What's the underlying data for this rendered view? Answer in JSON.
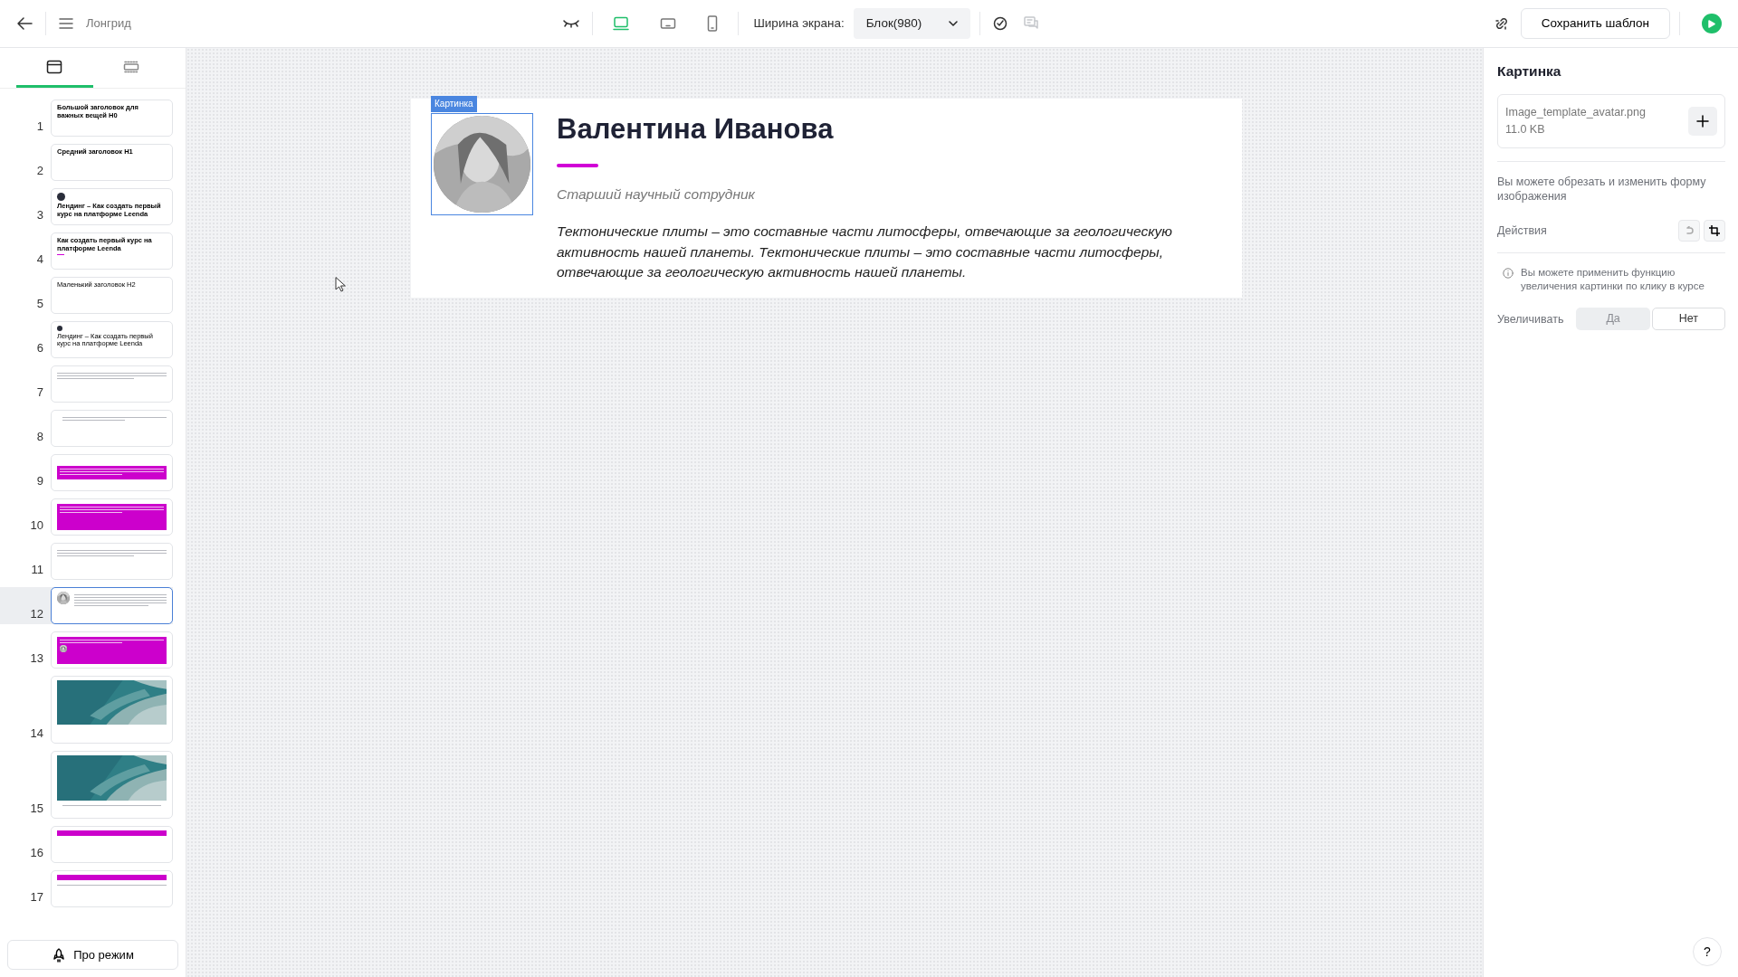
{
  "topbar": {
    "title": "Лонгрид",
    "width_label": "Ширина экрана:",
    "width_select": "Блок(980)",
    "save_button": "Сохранить шаблон",
    "devices": [
      {
        "kind": "desktop",
        "selected": true
      },
      {
        "kind": "tablet",
        "selected": false
      },
      {
        "kind": "mobile",
        "selected": false
      }
    ]
  },
  "sidebar": {
    "tabs": [
      {
        "kind": "blocks",
        "selected": true
      },
      {
        "kind": "layout",
        "selected": false
      }
    ],
    "slides": [
      {
        "number": "1",
        "kind": "heading",
        "title": "Большой заголовок для важных вещей H0",
        "selected": false
      },
      {
        "number": "2",
        "kind": "heading-medium",
        "title": "Средний заголовок H1",
        "selected": false
      },
      {
        "number": "3",
        "kind": "avatar-heading",
        "title": "Лендинг – Как создать первый курс на платформе Leenda",
        "selected": false
      },
      {
        "number": "4",
        "kind": "accent-heading",
        "title": "Как создать первый курс на платформе Leenda",
        "selected": false
      },
      {
        "number": "5",
        "kind": "heading-small",
        "title": "Маленький заголовок H2",
        "selected": false
      },
      {
        "number": "6",
        "kind": "avatar-small",
        "title": "Лендинг – Как создать первый курс на платформе Leenda",
        "selected": false
      },
      {
        "number": "7",
        "kind": "lines",
        "selected": false
      },
      {
        "number": "8",
        "kind": "quote",
        "selected": false
      },
      {
        "number": "9",
        "kind": "banner",
        "selected": false
      },
      {
        "number": "10",
        "kind": "banner-tall",
        "selected": false
      },
      {
        "number": "11",
        "kind": "lines",
        "selected": false
      },
      {
        "number": "12",
        "kind": "profile",
        "selected": true
      },
      {
        "number": "13",
        "kind": "banner-profile",
        "selected": false
      },
      {
        "number": "14",
        "selected": false
      },
      {
        "number": "15",
        "kind": "photo-caption",
        "selected": false
      },
      {
        "number": "16",
        "kind": "strip",
        "selected": false
      },
      {
        "number": "17",
        "kind": "strip-caption",
        "selected": false
      }
    ],
    "pro_button": "Про режим"
  },
  "block": {
    "image_tag": "Картинка",
    "name": "Валентина Иванова",
    "position": "Старший научный сотрудник",
    "text": "Тектонические плиты – это составные части литосферы, отвечающие за геологическую активность нашей планеты. Тектонические плиты – это составные части литосферы, отвечающие за геологическую активность нашей планеты."
  },
  "panel": {
    "title": "Картинка",
    "file_name": "Image_template_avatar.png",
    "file_size": "11.0 KB",
    "hint": "Вы можете обрезать и изменить форму изображения",
    "actions_label": "Действия",
    "info": "Вы можете применить функцию увеличения картинки по клику в курсе",
    "zoom_label": "Увеличивать",
    "zoom_options": [
      {
        "label": "Да",
        "selected": false
      },
      {
        "label": "Нет",
        "selected": true
      }
    ]
  },
  "help_button": "?"
}
